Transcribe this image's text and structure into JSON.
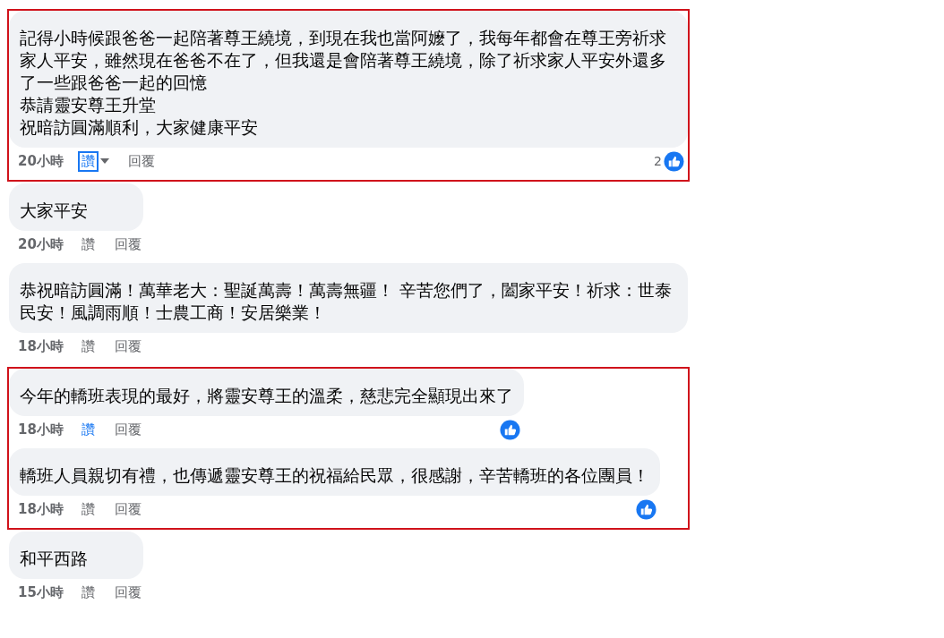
{
  "sections": [
    {
      "highlighted": true,
      "comments": [
        {
          "lines": [
            "記得小時候跟爸爸一起陪著尊王繞境，到現在我也當阿嬤了，我每年都會在尊王旁祈求家人平安，雖然現在爸爸不在了，但我還是會陪著尊王繞境，除了祈求家人平安外還多了一些跟爸爸一起的回憶",
            "恭請靈安尊王升堂",
            "祝暗訪圓滿順利，大家健康平安"
          ],
          "time": "20小時",
          "like": "讚",
          "liked": true,
          "focused": true,
          "reply": "回覆",
          "reacted": true,
          "reaction_count": "2"
        }
      ]
    },
    {
      "highlighted": false,
      "comments": [
        {
          "lines": [
            "大家平安"
          ],
          "time": "20小時",
          "like": "讚",
          "liked": false,
          "focused": false,
          "reply": "回覆",
          "reacted": false
        },
        {
          "lines": [
            "恭祝暗訪圓滿！萬華老大：聖誕萬壽！萬壽無疆！ 辛苦您們了，闔家平安！祈求：世泰民安！風調雨順！士農工商！安居樂業！"
          ],
          "time": "18小時",
          "like": "讚",
          "liked": false,
          "focused": false,
          "reply": "回覆",
          "reacted": false
        }
      ]
    },
    {
      "highlighted": true,
      "comments": [
        {
          "lines": [
            "今年的轎班表現的最好，將靈安尊王的溫柔，慈悲完全顯現出來了"
          ],
          "time": "18小時",
          "like": "讚",
          "liked": true,
          "focused": false,
          "reply": "回覆",
          "reacted": true
        },
        {
          "lines": [
            "轎班人員親切有禮，也傳遞靈安尊王的祝福給民眾，很感謝，辛苦轎班的各位團員！"
          ],
          "time": "18小時",
          "like": "讚",
          "liked": false,
          "focused": false,
          "reply": "回覆",
          "reacted": true
        }
      ]
    },
    {
      "highlighted": false,
      "comments": [
        {
          "lines": [
            "和平西路"
          ],
          "time": "15小時",
          "like": "讚",
          "liked": false,
          "focused": false,
          "reply": "回覆",
          "reacted": false
        }
      ]
    }
  ]
}
